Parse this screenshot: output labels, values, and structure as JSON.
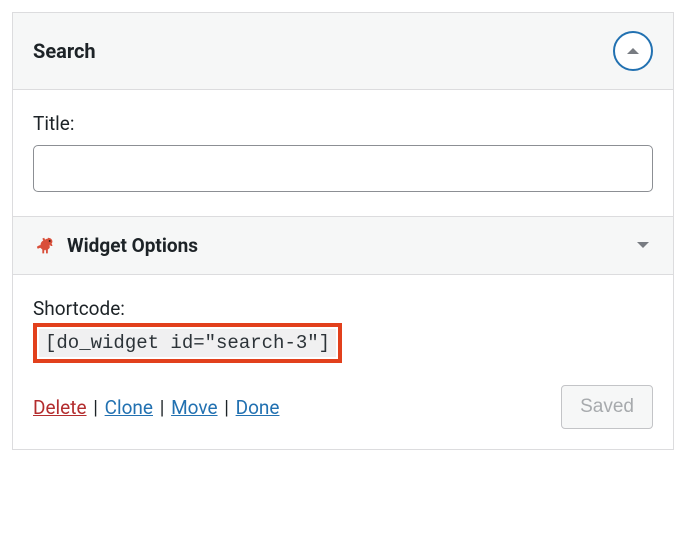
{
  "widget": {
    "title": "Search"
  },
  "body": {
    "title_label": "Title:",
    "title_value": ""
  },
  "options": {
    "heading": "Widget Options"
  },
  "footer": {
    "shortcode_label": "Shortcode:",
    "shortcode_value": "[do_widget id=\"search-3\"]"
  },
  "actions": {
    "delete": "Delete",
    "clone": "Clone",
    "move": "Move",
    "done": "Done",
    "saved": "Saved"
  }
}
